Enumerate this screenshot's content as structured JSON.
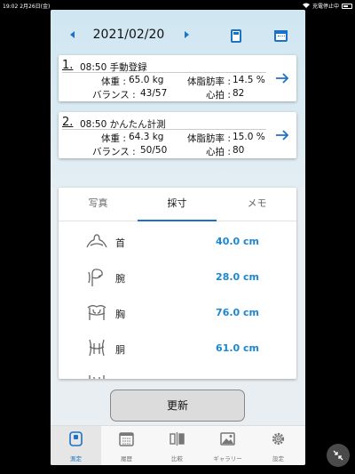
{
  "status": {
    "time": "19:02",
    "date": "2月26日(金)",
    "charging": "充電停止中"
  },
  "header": {
    "date": "2021/02/20"
  },
  "records": [
    {
      "index": "1.",
      "time": "08:50",
      "title": "手動登録",
      "weight_label": "体重 :",
      "weight": "65.0 kg",
      "fat_label": "体脂肪率 :",
      "fat": "14.5 %",
      "balance_label": "バランス :",
      "balance": "43/57",
      "heart_label": "心拍 :",
      "heart": "82"
    },
    {
      "index": "2.",
      "time": "08:50",
      "title": "かんたん計測",
      "weight_label": "体重 :",
      "weight": "64.3 kg",
      "fat_label": "体脂肪率 :",
      "fat": "15.0 %",
      "balance_label": "バランス :",
      "balance": "50/50",
      "heart_label": "心拍 :",
      "heart": "80"
    }
  ],
  "tabs": [
    "写真",
    "採寸",
    "メモ"
  ],
  "active_tab": "採寸",
  "measurements": [
    {
      "part": "首",
      "value": "40.0 cm",
      "icon": "neck-icon"
    },
    {
      "part": "腕",
      "value": "28.0 cm",
      "icon": "arm-icon"
    },
    {
      "part": "胸",
      "value": "76.0 cm",
      "icon": "chest-icon"
    },
    {
      "part": "胴",
      "value": "61.0 cm",
      "icon": "waist-icon"
    }
  ],
  "update_button": "更新",
  "tabbar": [
    {
      "label": "測定",
      "icon": "measure-icon",
      "active": true
    },
    {
      "label": "履歴",
      "icon": "calendar-icon",
      "active": false
    },
    {
      "label": "比較",
      "icon": "compare-icon",
      "active": false
    },
    {
      "label": "ギャラリー",
      "icon": "gallery-icon",
      "active": false
    },
    {
      "label": "設定",
      "icon": "gear-icon",
      "active": false
    }
  ],
  "colors": {
    "accent": "#1c72c6",
    "value": "#1a88cf"
  }
}
